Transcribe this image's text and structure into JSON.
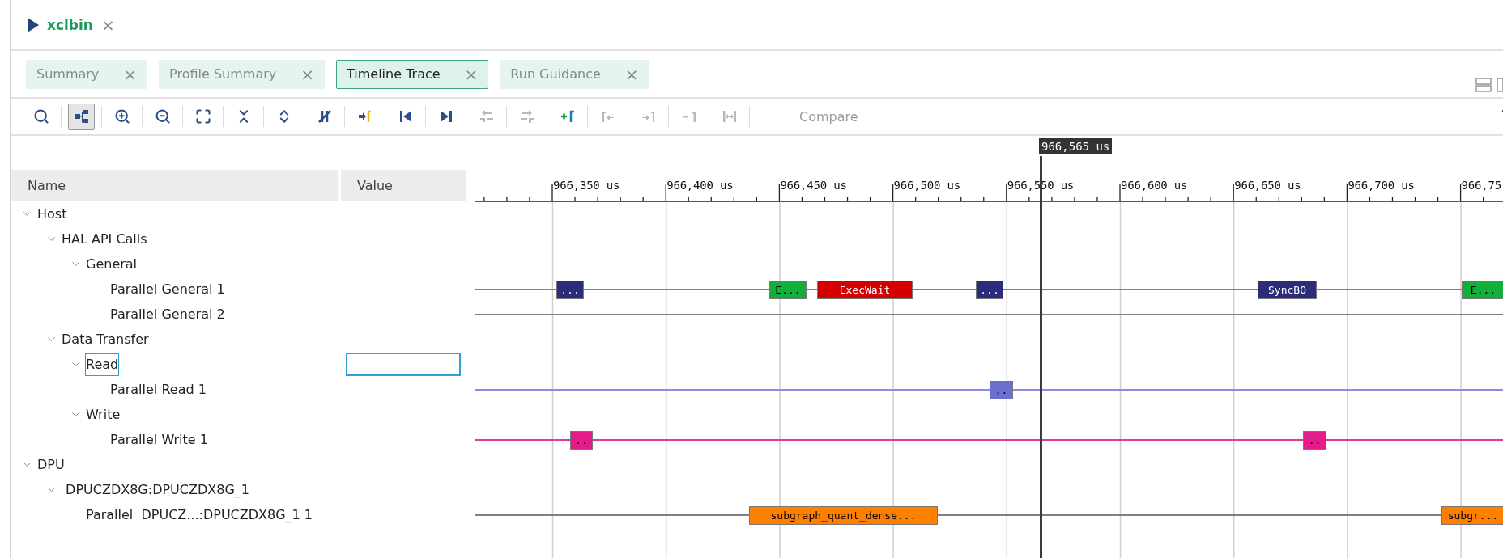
{
  "editor_tab": {
    "title": "xclbin",
    "close": "×"
  },
  "tabs": [
    {
      "label": "Summary",
      "selected": false,
      "close": "×"
    },
    {
      "label": "Profile Summary",
      "selected": false,
      "close": "×"
    },
    {
      "label": "Timeline Trace",
      "selected": true,
      "close": "×"
    },
    {
      "label": "Run Guidance",
      "selected": false,
      "close": "×"
    }
  ],
  "toolbar": [
    {
      "kind": "search",
      "disabled": false,
      "pressed": false
    },
    {
      "kind": "hierarchy",
      "disabled": false,
      "pressed": true
    },
    {
      "kind": "zoom-in",
      "disabled": false,
      "pressed": false
    },
    {
      "kind": "zoom-out",
      "disabled": false,
      "pressed": false
    },
    {
      "kind": "fit",
      "disabled": false,
      "pressed": false
    },
    {
      "kind": "collapse",
      "disabled": false,
      "pressed": false
    },
    {
      "kind": "expand",
      "disabled": false,
      "pressed": false
    },
    {
      "kind": "marker-off",
      "disabled": false,
      "pressed": false
    },
    {
      "kind": "add-marker",
      "disabled": false,
      "pressed": false
    },
    {
      "kind": "first",
      "disabled": false,
      "pressed": false
    },
    {
      "kind": "last",
      "disabled": false,
      "pressed": false
    },
    {
      "kind": "prev-change",
      "disabled": true,
      "pressed": false
    },
    {
      "kind": "next-change",
      "disabled": true,
      "pressed": false
    },
    {
      "kind": "new-marker",
      "disabled": false,
      "pressed": false
    },
    {
      "kind": "marker-left",
      "disabled": true,
      "pressed": false
    },
    {
      "kind": "marker-right",
      "disabled": true,
      "pressed": false
    },
    {
      "kind": "remove-marker",
      "disabled": true,
      "pressed": false
    },
    {
      "kind": "span",
      "disabled": true,
      "pressed": false
    }
  ],
  "compare": {
    "label": "Compare",
    "disabled": true
  },
  "cursor": {
    "label": "966,565 us"
  },
  "columns": [
    "Name",
    "Value"
  ],
  "axis": {
    "ticks": [
      "966,350 us",
      "966,400 us",
      "966,450 us",
      "966,500 us",
      "966,550 us",
      "966,600 us",
      "966,650 us",
      "966,700 us",
      "966,75"
    ]
  },
  "tree": [
    {
      "label": "Host",
      "expanded": true,
      "selected": false,
      "children": [
        {
          "label": "HAL API Calls",
          "expanded": true,
          "selected": false,
          "children": [
            {
              "label": "General",
              "expanded": true,
              "selected": false,
              "children": [
                {
                  "label": "Parallel General 1",
                  "selected": false,
                  "track": {
                    "color": "#808080",
                    "events": [
                      {
                        "label": "...",
                        "color": "#2b2d7a"
                      },
                      {
                        "label": "E...",
                        "color": "#12b03a"
                      },
                      {
                        "label": "ExecWait",
                        "color": "#d40000"
                      },
                      {
                        "label": "...",
                        "color": "#2b2d7a"
                      },
                      {
                        "label": "SyncBO",
                        "color": "#2b2d7a"
                      },
                      {
                        "label": "E...",
                        "color": "#12b03a"
                      }
                    ]
                  }
                },
                {
                  "label": "Parallel General 2",
                  "selected": false,
                  "track": {
                    "color": "#808080"
                  }
                }
              ]
            }
          ]
        },
        {
          "label": "Data Transfer",
          "expanded": true,
          "selected": false,
          "children": [
            {
              "label": "Read",
              "expanded": true,
              "selected": true,
              "children": [
                {
                  "label": "Parallel Read 1",
                  "selected": false,
                  "track": {
                    "color": "#8a8ce6",
                    "events": [
                      {
                        "label": "..",
                        "color": "#6b6fcf"
                      }
                    ]
                  }
                }
              ]
            },
            {
              "label": "Write",
              "expanded": true,
              "selected": false,
              "children": [
                {
                  "label": "Parallel Write 1",
                  "selected": false,
                  "track": {
                    "color": "#e8379a",
                    "events": [
                      {
                        "label": "..",
                        "color": "#e41b8a"
                      },
                      {
                        "label": "..",
                        "color": "#e41b8a"
                      }
                    ]
                  }
                }
              ]
            }
          ]
        }
      ]
    },
    {
      "label": "DPU",
      "expanded": true,
      "selected": false,
      "children": [
        {
          "label": " DPUCZDX8G:DPUCZDX8G_1",
          "expanded": true,
          "selected": false,
          "children": [
            {
              "label": "Parallel  DPUCZ...:DPUCZDX8G_1 1",
              "selected": false,
              "track": {
                "color": "#808080",
                "events": [
                  {
                    "label": "subgraph_quant_dense...",
                    "color": "#ff7f00"
                  },
                  {
                    "label": "subgr...",
                    "color": "#ff7f00"
                  }
                ]
              }
            }
          ]
        }
      ]
    }
  ]
}
